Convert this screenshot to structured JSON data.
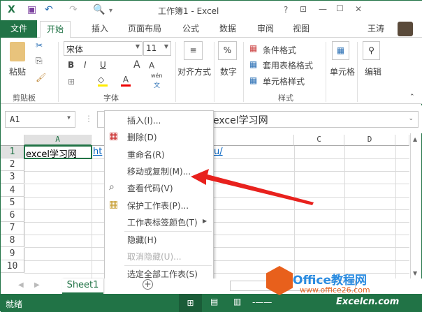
{
  "window": {
    "title": "工作簿1 - Excel",
    "help": "?",
    "minimize": "—",
    "maximize": "☐",
    "close": "✕"
  },
  "user": {
    "name": "王涛"
  },
  "tabs": {
    "file": "文件",
    "home": "开始",
    "insert": "插入",
    "layout": "页面布局",
    "formulas": "公式",
    "data": "数据",
    "review": "审阅",
    "view": "视图"
  },
  "ribbon": {
    "clipboard": {
      "paste": "粘贴",
      "label": "剪贴板"
    },
    "font": {
      "name": "宋体",
      "size": "11",
      "bold": "B",
      "italic": "I",
      "underline": "U",
      "grow": "A",
      "shrink": "A",
      "label": "字体",
      "phonetic_top": "wén",
      "phonetic_bottom": "文"
    },
    "alignment": {
      "label": "对齐方式"
    },
    "number": {
      "label": "数字",
      "icon": "%"
    },
    "styles": {
      "conditional": "条件格式",
      "table": "套用表格格式",
      "cell_styles": "单元格样式",
      "label": "样式"
    },
    "cells": {
      "label": "单元格"
    },
    "editing": {
      "label": "编辑"
    }
  },
  "formula_bar": {
    "name_box": "A1",
    "content": "excel学习网"
  },
  "grid": {
    "columns": [
      "A",
      "C",
      "D"
    ],
    "rows": [
      "1",
      "2",
      "3",
      "4",
      "5",
      "6",
      "7",
      "8",
      "9",
      "10"
    ],
    "a1": "excel学习网",
    "b1_start": "ht",
    "b1_end": "u/"
  },
  "context_menu": {
    "items": [
      {
        "label": "插入(I)...",
        "disabled": false
      },
      {
        "label": "删除(D)",
        "disabled": false
      },
      {
        "label": "重命名(R)",
        "disabled": false
      },
      {
        "label": "移动或复制(M)...",
        "disabled": false
      },
      {
        "label": "查看代码(V)",
        "disabled": false
      },
      {
        "label": "保护工作表(P)...",
        "disabled": false
      },
      {
        "label": "工作表标签颜色(T)",
        "disabled": false
      },
      {
        "label": "隐藏(H)",
        "disabled": false
      },
      {
        "label": "取消隐藏(U)...",
        "disabled": true
      },
      {
        "label": "选定全部工作表(S)",
        "disabled": false
      }
    ]
  },
  "sheets": {
    "active": "Sheet1",
    "add": "+"
  },
  "status": {
    "ready": "就绪"
  },
  "watermark": {
    "brand": "Office教程网",
    "url": "www.office26.com",
    "site": "Excelcn.com"
  },
  "colors": {
    "accent": "#217346",
    "arrow": "#e8211d"
  }
}
